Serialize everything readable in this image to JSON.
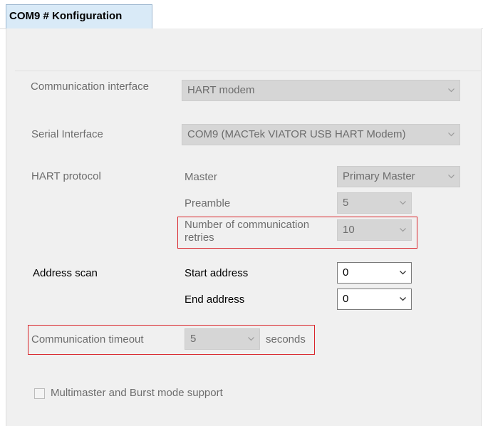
{
  "tab": {
    "title": "COM9 # Konfiguration"
  },
  "communication_interface": {
    "label": "Communication interface",
    "value": "HART modem"
  },
  "serial_interface": {
    "label": "Serial Interface",
    "value": "COM9 (MACTek VIATOR USB HART Modem)"
  },
  "hart_protocol": {
    "label": "HART protocol",
    "master": {
      "label": "Master",
      "value": "Primary Master"
    },
    "preamble": {
      "label": "Preamble",
      "value": "5"
    },
    "retries": {
      "label_line1": "Number of communication",
      "label_line2": "retries",
      "value": "10"
    }
  },
  "address_scan": {
    "label": "Address scan",
    "start": {
      "label": "Start address",
      "value": "0"
    },
    "end": {
      "label": "End address",
      "value": "0"
    }
  },
  "timeout": {
    "label": "Communication timeout",
    "value": "5",
    "unit": "seconds"
  },
  "multimaster": {
    "label": "Multimaster and Burst mode support",
    "checked": false
  },
  "colors": {
    "tab_bg": "#d9eaf7",
    "panel_bg": "#f0f0f0",
    "highlight": "#d9262c",
    "disabled_field": "#d6d6d6"
  },
  "icons": {
    "dropdown": "chevron-down-icon"
  }
}
